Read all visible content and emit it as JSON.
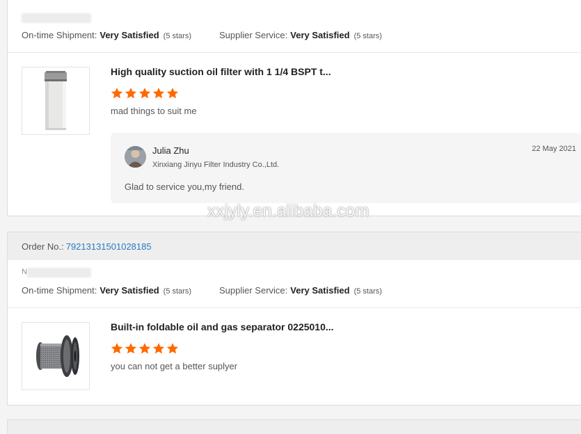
{
  "watermark": "xxjyly.en.alibaba.com",
  "orders": [
    {
      "ratings": {
        "shipment_label": "On-time Shipment:",
        "shipment_value": "Very Satisfied",
        "shipment_stars": "(5 stars)",
        "service_label": "Supplier Service:",
        "service_value": "Very Satisfied",
        "service_stars": "(5 stars)"
      },
      "product": {
        "title": "High quality suction oil filter with 1 1/4 BSPT t...",
        "stars": 5,
        "review": "mad things to suit me"
      },
      "reply": {
        "name": "Julia Zhu",
        "company": "Xinxiang Jinyu Filter Industry Co.,Ltd.",
        "date": "22 May 2021",
        "text": "Glad to service you,my friend."
      }
    },
    {
      "order_label": "Order No.:",
      "order_number": "79213131501028185",
      "buyer_initial": "N",
      "ratings": {
        "shipment_label": "On-time Shipment:",
        "shipment_value": "Very Satisfied",
        "shipment_stars": "(5 stars)",
        "service_label": "Supplier Service:",
        "service_value": "Very Satisfied",
        "service_stars": "(5 stars)"
      },
      "product": {
        "title": "Built-in foldable oil and gas separator 0225010...",
        "stars": 5,
        "review": "you can not get a better suplyer"
      }
    }
  ],
  "colors": {
    "star": "#ff6a00",
    "link": "#2a7ac0"
  }
}
